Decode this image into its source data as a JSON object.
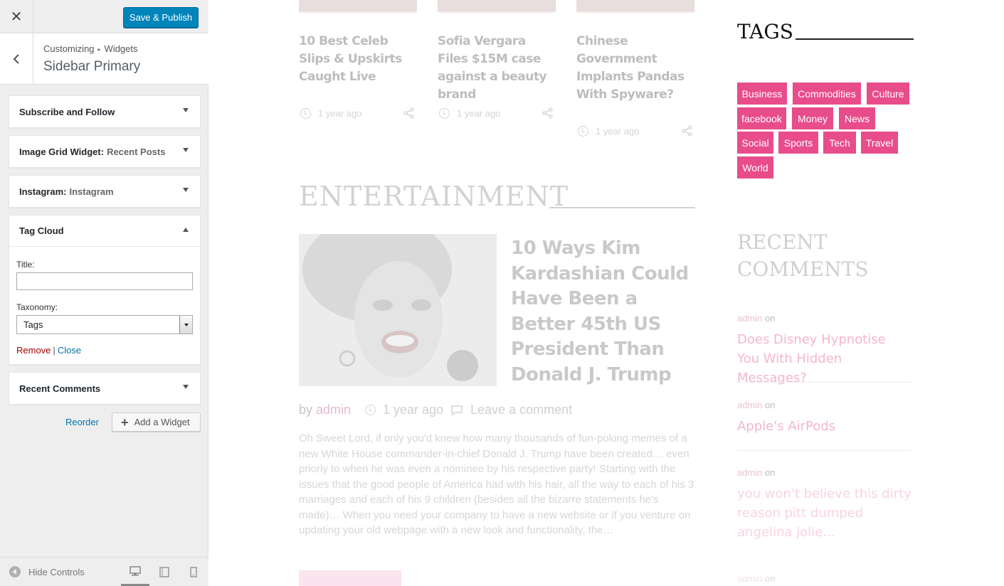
{
  "customizer": {
    "publish_label": "Save & Publish",
    "breadcrumb": {
      "root": "Customizing",
      "section": "Widgets"
    },
    "section_title": "Sidebar Primary",
    "widgets": [
      {
        "title": "Subscribe and Follow",
        "subtitle": ""
      },
      {
        "title": "Image Grid Widget:",
        "subtitle": "Recent Posts"
      },
      {
        "title": "Instagram:",
        "subtitle": "Instagram"
      },
      {
        "title": "Tag Cloud",
        "subtitle": ""
      },
      {
        "title": "Recent Comments",
        "subtitle": ""
      }
    ],
    "tag_cloud_form": {
      "title_label": "Title:",
      "title_value": "",
      "taxonomy_label": "Taxonomy:",
      "taxonomy_value": "Tags",
      "remove_label": "Remove",
      "separator": "|",
      "close_label": "Close"
    },
    "reorder_label": "Reorder",
    "add_widget_label": "Add a Widget",
    "hide_controls_label": "Hide Controls"
  },
  "preview": {
    "related_posts": [
      {
        "title": "10 Best Celeb Slips & Upskirts Caught Live",
        "time": "1 year ago"
      },
      {
        "title": "Sofia Vergara Files $15M case against a beauty brand",
        "time": "1 year ago"
      },
      {
        "title": "Chinese Government Implants Pandas With Spyware?",
        "time": "1 year ago"
      }
    ],
    "entertainment": {
      "heading": "ENTERTAINMENT",
      "title": "10 Ways Kim Kardashian Could Have Been a Better 45th US President Than Donald J. Trump",
      "by": "by",
      "author": "admin",
      "time": "1 year ago",
      "comment": "Leave a comment",
      "excerpt": "Oh Sweet Lord, if only you'd knew how many thousands of fun-poking memes of a new White House commander-in-chief Donald J. Trump have been created… even priorly to when he was even a nominee by his respective party! Starting with the issues that the good people of America had with his hair, all the way to each of his 3 marriages and each of his 9 children (besides all the bizarre statements he's made)… When you need your company to have a new website or if you venture on updating your old webpage with a new look and functionality, the…"
    },
    "tags": {
      "heading": "TAGS",
      "items": [
        "Business",
        "Commodities",
        "Culture",
        "facebook",
        "Money",
        "News",
        "Social",
        "Sports",
        "Tech",
        "Travel",
        "World"
      ],
      "color": "#e84c8b"
    },
    "recent_comments": {
      "heading_line1": "RECENT",
      "heading_line2": "COMMENTS",
      "items": [
        {
          "author": "admin",
          "on": "on",
          "post": "Does Disney Hypnotise You With Hidden Messages?"
        },
        {
          "author": "admin",
          "on": "on",
          "post": "Apple's AirPods"
        },
        {
          "author": "admin",
          "on": "on",
          "post": "you won't believe this dirty reason pitt dumped angelina jolie…"
        },
        {
          "author": "admin",
          "on": "on",
          "post": ""
        }
      ]
    }
  },
  "colors": {
    "primary_button": "#0085ba",
    "link": "#0073aa",
    "remove": "#aa0000",
    "tag_pink": "#e84c8b"
  }
}
